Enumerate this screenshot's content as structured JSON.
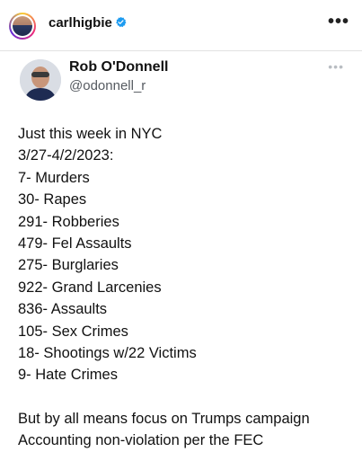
{
  "post": {
    "username": "carlhigbie",
    "more_icon": "more-horizontal-icon"
  },
  "tweet": {
    "name": "Rob O'Donnell",
    "handle": "@odonnell_r",
    "lines": [
      "Just this week in NYC",
      "3/27-4/2/2023:",
      "7- Murders",
      "30- Rapes",
      "291- Robberies",
      "479- Fel Assaults",
      "275- Burglaries",
      "922- Grand Larcenies",
      "836- Assaults",
      "105- Sex Crimes",
      "18- Shootings w/22 Victims",
      "9- Hate Crimes"
    ],
    "closing_lines": [
      "But by all means focus on Trumps campaign",
      "Accounting non-violation per the FEC"
    ]
  },
  "colors": {
    "verified_blue": "#1d9bf0",
    "handle_gray": "#555a60"
  }
}
